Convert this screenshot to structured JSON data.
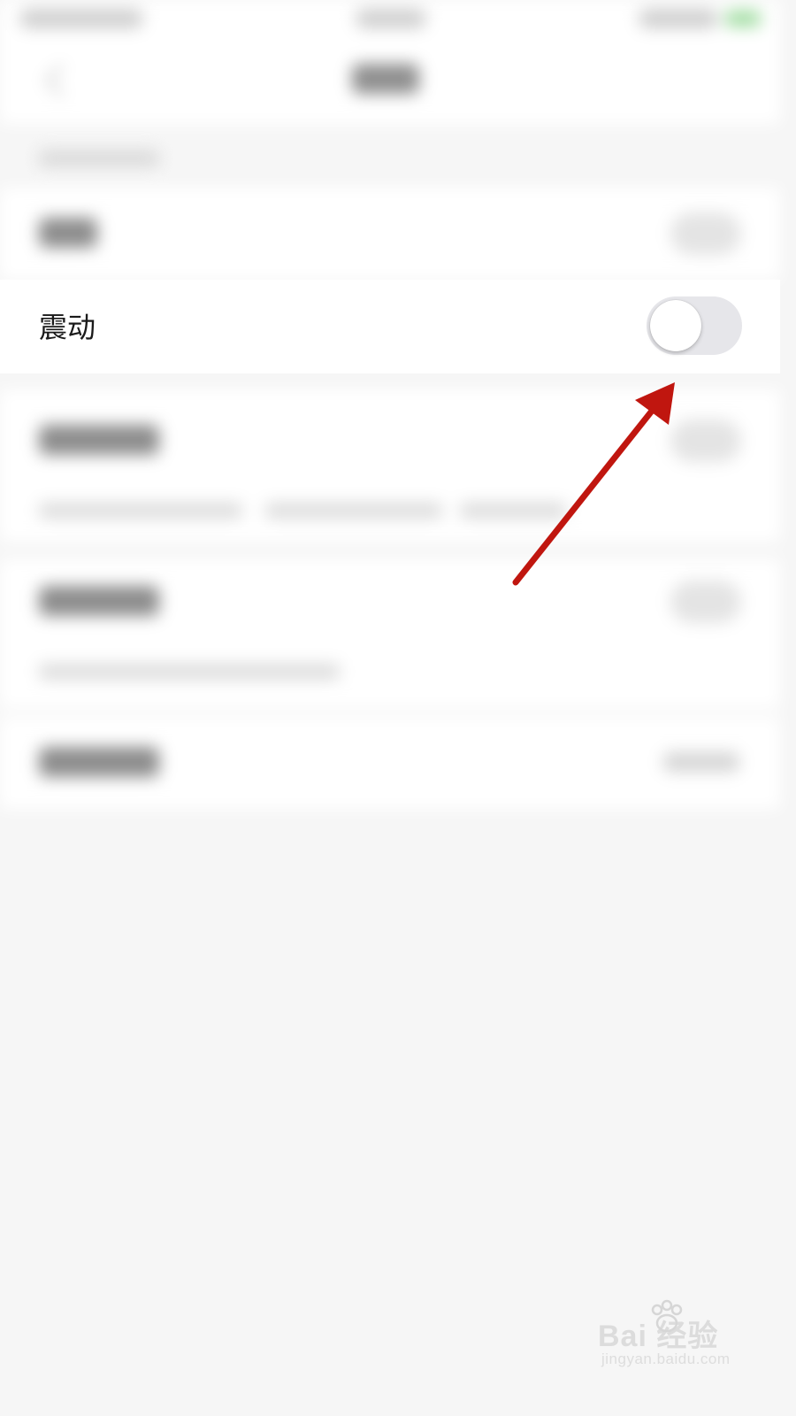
{
  "settings": {
    "vibration": {
      "label": "震动",
      "enabled": false
    }
  },
  "watermark": {
    "brand": "Bai  经验",
    "domain": "jingyan.baidu.com"
  },
  "colors": {
    "page_background": "#f6f6f6",
    "toggle_off_track": "#e6e6ea",
    "annotation_arrow": "#c0160f"
  }
}
